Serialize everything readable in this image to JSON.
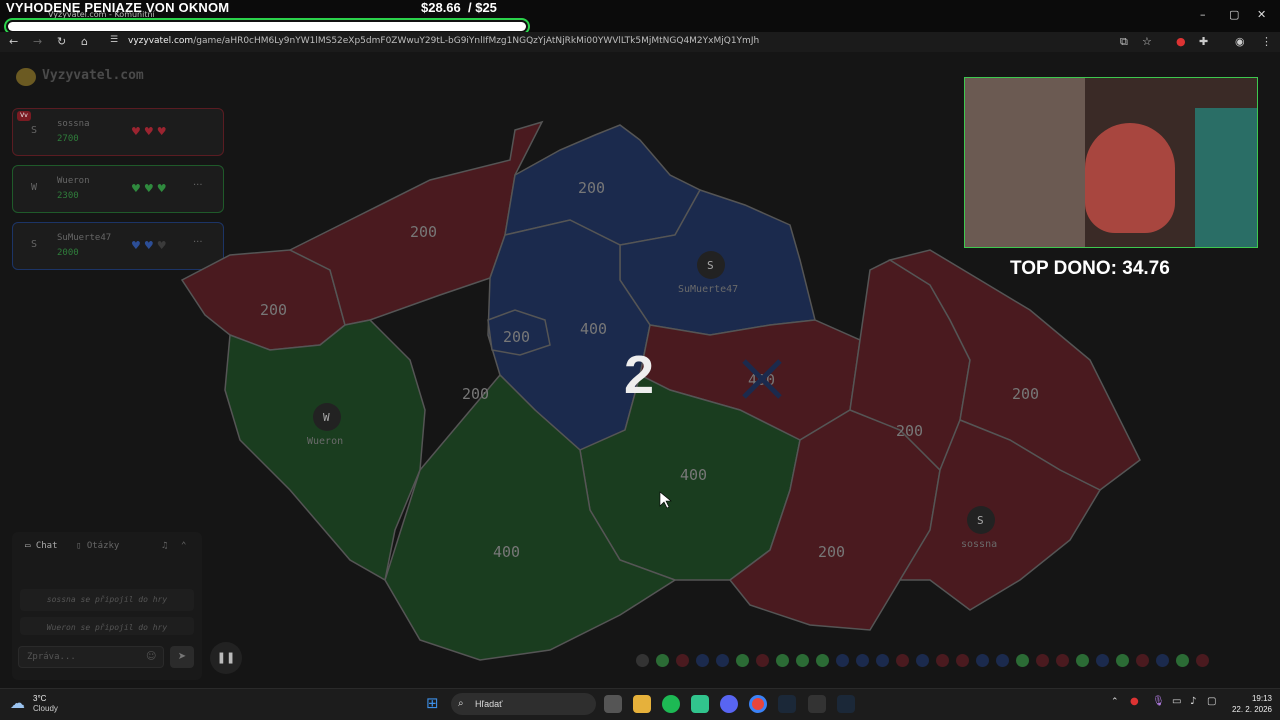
{
  "overlay": {
    "title": "VYHODENE PENIAZE VON OKNOM",
    "amount": "$28.66",
    "goal": "/ $25",
    "top_dono": "TOP DONO: 34.76"
  },
  "browser": {
    "tab_title": "Vyzyvatel.com - Komunitní",
    "url_host": "vyzyvatel.com",
    "url_path": "/game/aHR0cHM6Ly9nYW1lMS52eXp5dmF0ZWwuY29tL-bG9iYnlIfMzg1NGQzYjAtNjRkMi00YWVlLTk5MjMtNGQ4M2YxMjQ1YmJh"
  },
  "game": {
    "logo": "Vyzyvatel.com",
    "round_number": "2",
    "players": [
      {
        "avatar": "S",
        "name": "sossna",
        "score": "2700",
        "color": "#7a1b22",
        "hearts": [
          "#9b2430",
          "#9b2430",
          "#9b2430"
        ],
        "badge": "Vv"
      },
      {
        "avatar": "W",
        "name": "Wueron",
        "score": "2300",
        "color": "#1f5a2a",
        "hearts": [
          "#2f8a3e",
          "#2f8a3e",
          "#2f8a3e"
        ],
        "more": "···"
      },
      {
        "avatar": "S",
        "name": "SuMuerte47",
        "score": "2000",
        "color": "#1c3466",
        "hearts": [
          "#2c4e96",
          "#2c4e96",
          "#3a3a3a"
        ],
        "more": "···"
      }
    ],
    "regions": [
      {
        "value": "200",
        "owner": "red"
      },
      {
        "value": "200",
        "owner": "red"
      },
      {
        "value": "200",
        "owner": "blue"
      },
      {
        "value": "200",
        "owner": "blue"
      },
      {
        "value": "400",
        "owner": "blue"
      },
      {
        "value": "400",
        "owner": "red"
      },
      {
        "value": "200",
        "owner": "green"
      },
      {
        "value": "400",
        "owner": "green"
      },
      {
        "value": "400",
        "owner": "green"
      },
      {
        "value": "200",
        "owner": "red"
      },
      {
        "value": "200",
        "owner": "red"
      },
      {
        "value": "200",
        "owner": "red"
      }
    ],
    "pins": [
      {
        "letter": "S",
        "name": "SuMuerte47"
      },
      {
        "letter": "W",
        "name": "Wueron"
      },
      {
        "letter": "S",
        "name": "sossna"
      }
    ]
  },
  "chat": {
    "tab_chat": "Chat",
    "tab_questions": "Otázky",
    "messages": [
      "sossna se připojil do hry",
      "Wueron se připojil do hry"
    ],
    "input_placeholder": "Zpráva..."
  },
  "colors": {
    "red": "#4a1a1f",
    "blue": "#1b2a4d",
    "green": "#1a3d1f",
    "border": "#555555"
  },
  "history": [
    "#333",
    "#2b6b35",
    "#4a1a1f",
    "#1b2a4d",
    "#1b2a4d",
    "#2b6b35",
    "#4a1a1f",
    "#2b6b35",
    "#2b6b35",
    "#2b6b35",
    "#1b2a4d",
    "#1b2a4d",
    "#1b2a4d",
    "#4a1a1f",
    "#1b2a4d",
    "#4a1a1f",
    "#4a1a1f",
    "#1b2a4d",
    "#1b2a4d",
    "#2b6b35",
    "#4a1a1f",
    "#4a1a1f",
    "#2b6b35",
    "#1b2a4d",
    "#2b6b35",
    "#4a1a1f",
    "#1b2a4d",
    "#2b6b35",
    "#4a1a1f"
  ],
  "taskbar": {
    "temp": "3°C",
    "condition": "Cloudy",
    "search": "Hľadať",
    "time": "19:13",
    "date": "22. 2. 2026"
  }
}
